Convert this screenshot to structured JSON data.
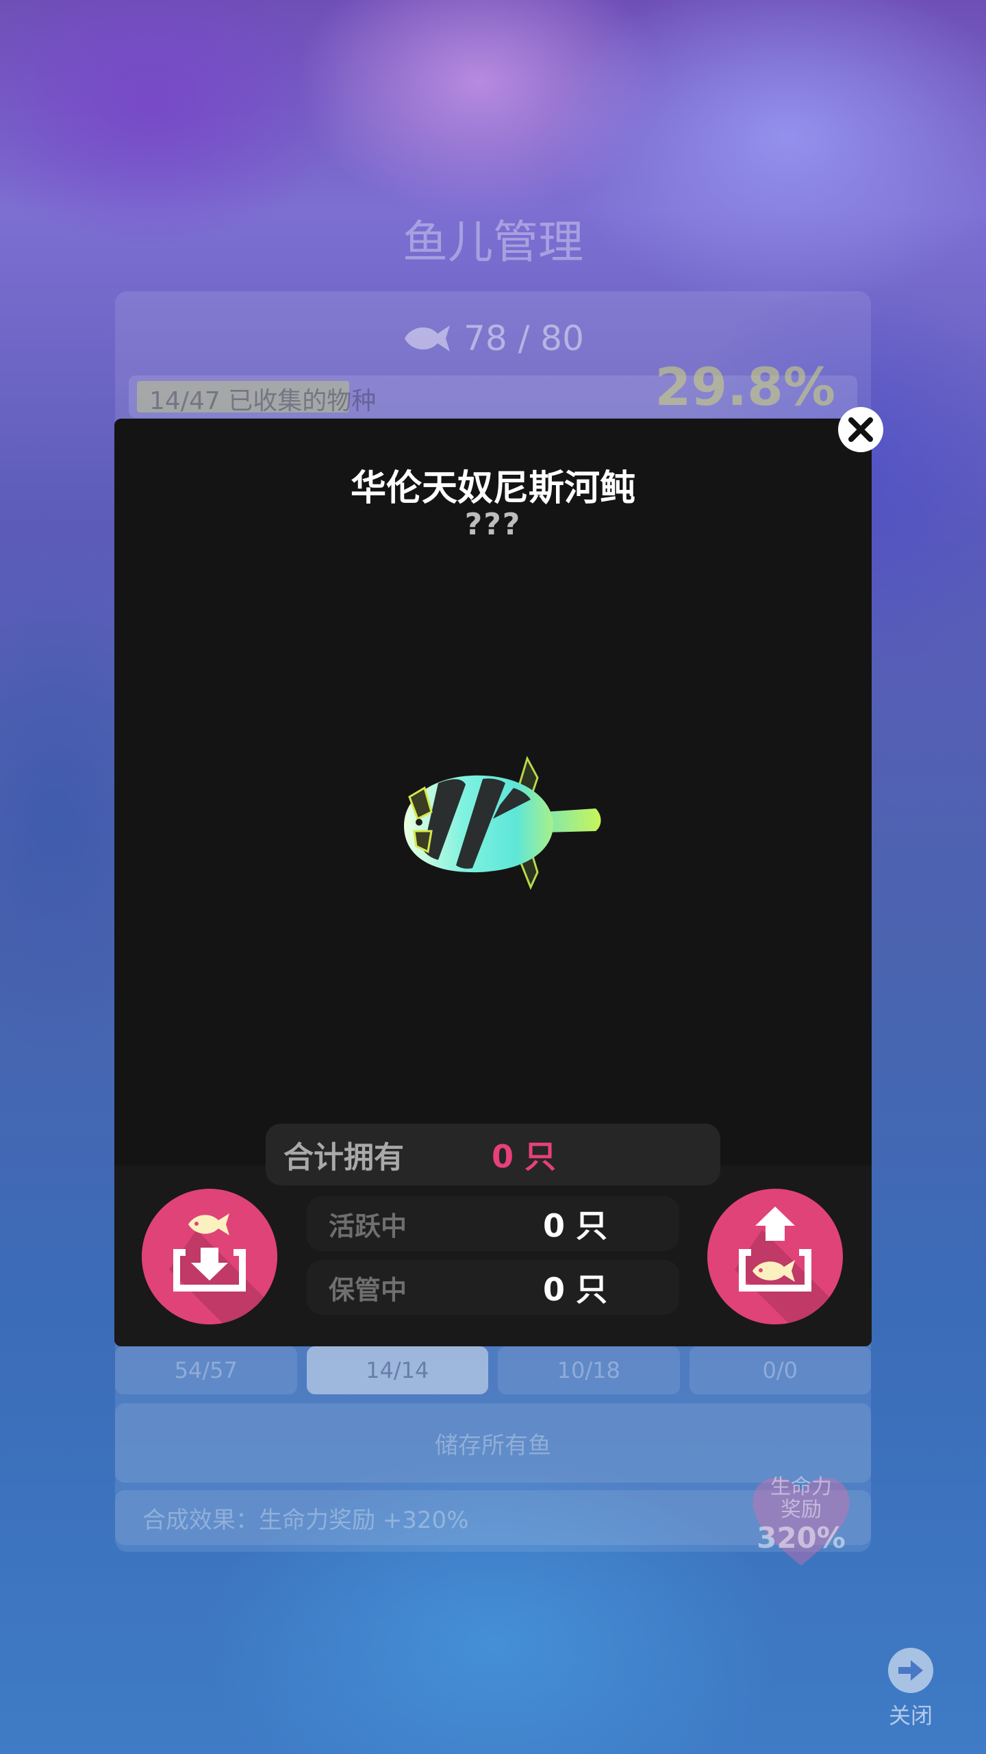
{
  "background": {
    "title": "鱼儿管理",
    "fish_count": "78 / 80",
    "collection": {
      "label": "14/47 已收集的物种",
      "percent": "29.8%",
      "progress_fraction": 0.298
    },
    "tabs": [
      {
        "label": "54/57",
        "active": false
      },
      {
        "label": "14/14",
        "active": true
      },
      {
        "label": "10/18",
        "active": false
      },
      {
        "label": "0/0",
        "active": false
      }
    ],
    "store_all_label": "储存所有鱼",
    "effect_label": "合成效果：生命力奖励 +320%",
    "heart_badge": {
      "label": "生命力奖励",
      "line1": "生命力",
      "line2": "奖励",
      "value": "320%"
    },
    "close_label": "关闭"
  },
  "modal": {
    "fish_name": "华伦天奴尼斯河鲀",
    "fish_subtitle": "???",
    "fish_icon": "pufferfish-icon",
    "stats": {
      "total": {
        "label": "合计拥有",
        "value": "0 只"
      },
      "active": {
        "label": "活跃中",
        "value": "0 只"
      },
      "stored": {
        "label": "保管中",
        "value": "0 只"
      }
    },
    "store_button_icon": "fish-into-box-icon",
    "release_button_icon": "fish-out-of-box-icon"
  },
  "colors": {
    "accent_pink": "#e04378",
    "modal_bg": "#141414",
    "pink_text": "#e8407a"
  }
}
